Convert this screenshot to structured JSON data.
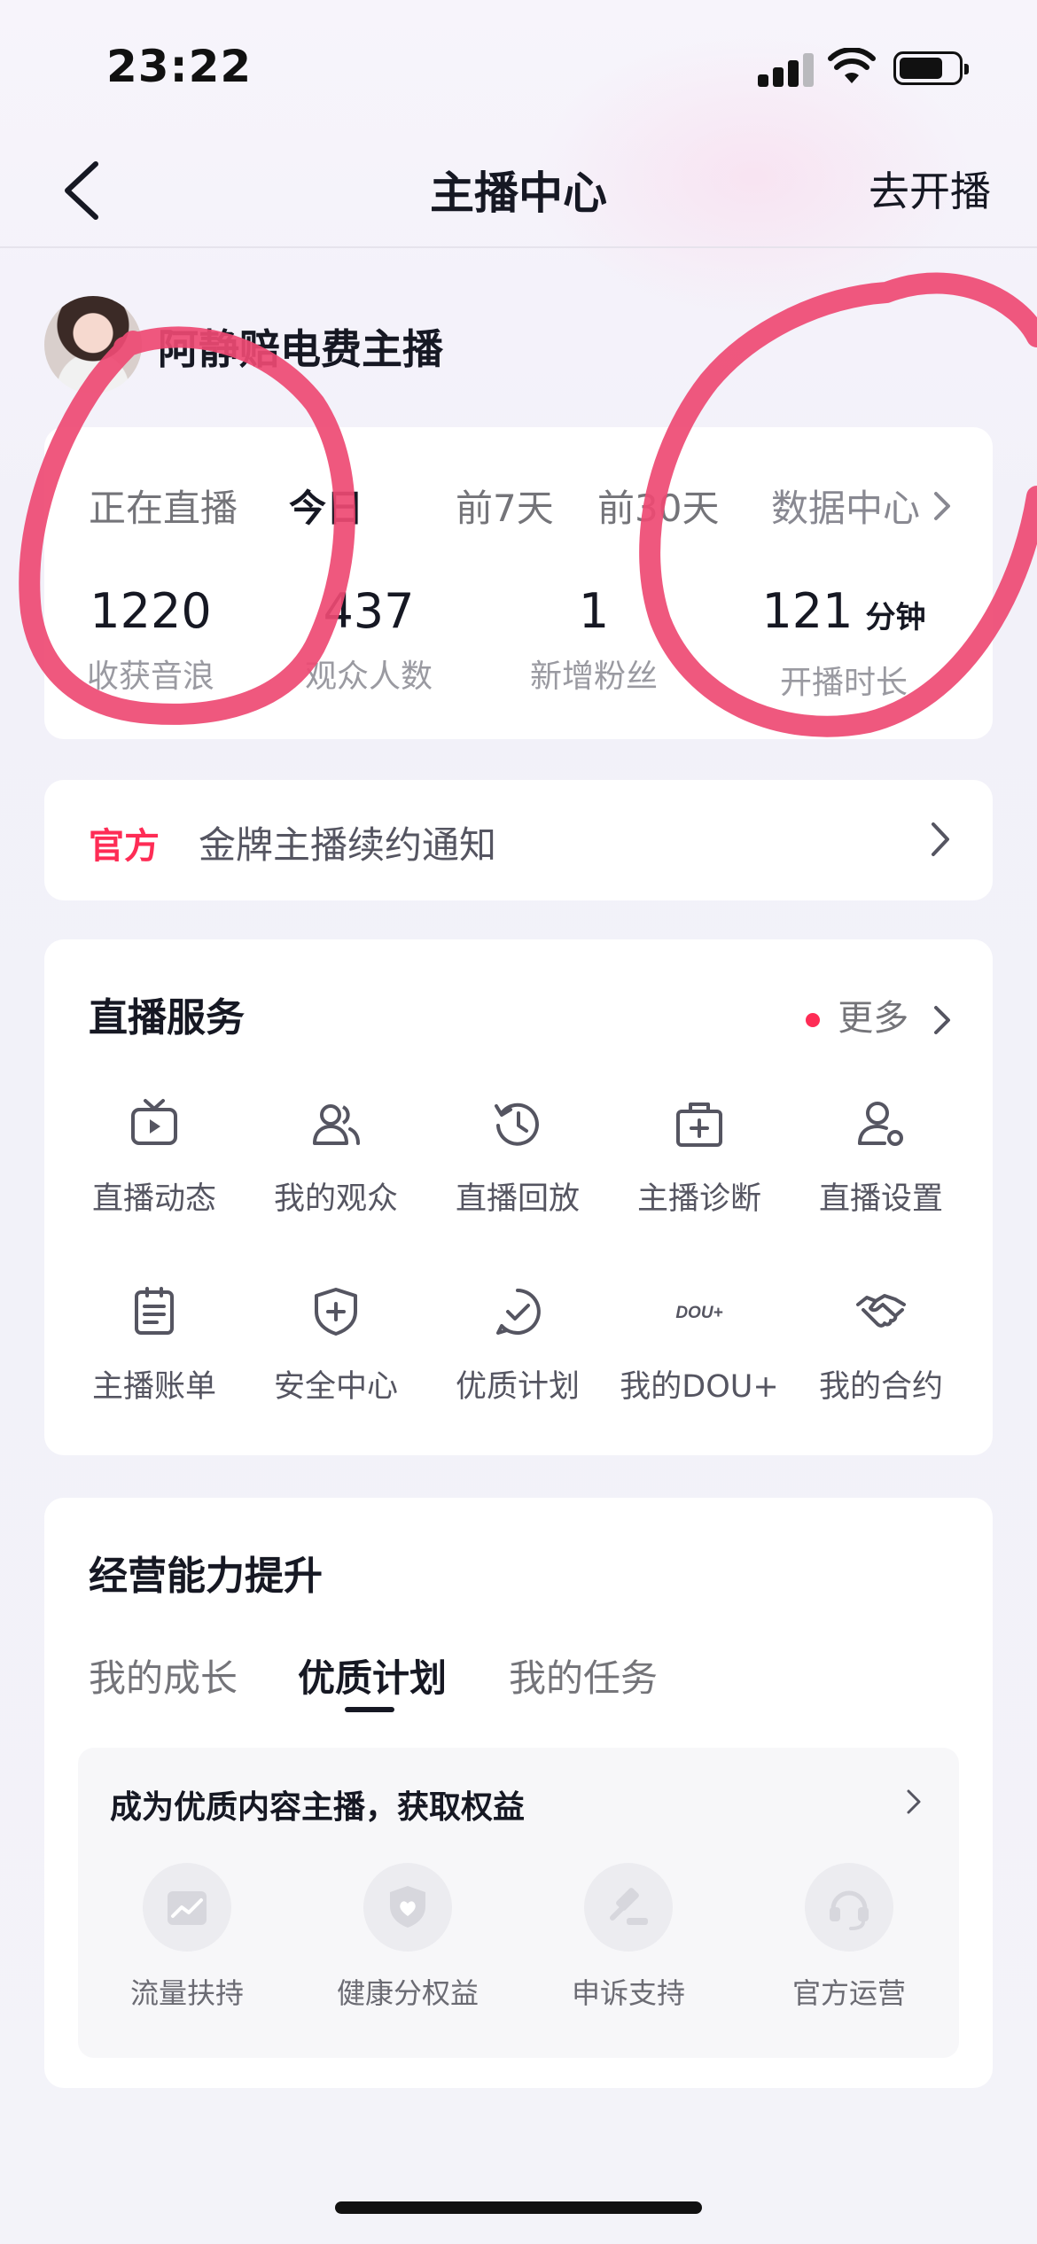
{
  "status_bar": {
    "time": "23:22",
    "signal_bars": 4,
    "battery_level": 0.75
  },
  "nav": {
    "title": "主播中心",
    "action": "去开播",
    "back_icon": "chevron-left-icon"
  },
  "profile": {
    "name": "阿静赔电费主播"
  },
  "stats": {
    "tabs": [
      "正在直播",
      "今日",
      "前7天",
      "前30天"
    ],
    "active_tab": "今日",
    "data_center_label": "数据中心",
    "items": [
      {
        "value": "1220",
        "label": "收获音浪",
        "unit": ""
      },
      {
        "value": "437",
        "label": "观众人数",
        "unit": ""
      },
      {
        "value": "1",
        "label": "新增粉丝",
        "unit": ""
      },
      {
        "value": "121",
        "label": "开播时长",
        "unit": "分钟"
      }
    ]
  },
  "notice": {
    "tag": "官方",
    "text": "金牌主播续约通知"
  },
  "services": {
    "title": "直播服务",
    "more_label": "更多",
    "accent": "#fe2c55",
    "items": [
      {
        "label": "直播动态",
        "icon": "tv-play-icon"
      },
      {
        "label": "我的观众",
        "icon": "audience-icon"
      },
      {
        "label": "直播回放",
        "icon": "replay-clock-icon"
      },
      {
        "label": "主播诊断",
        "icon": "medical-kit-icon"
      },
      {
        "label": "直播设置",
        "icon": "user-settings-icon"
      },
      {
        "label": "主播账单",
        "icon": "bill-icon"
      },
      {
        "label": "安全中心",
        "icon": "shield-plus-icon"
      },
      {
        "label": "优质计划",
        "icon": "check-bubble-icon"
      },
      {
        "label": "我的DOU+",
        "icon": "dou-plus-icon",
        "icon_text": "DOU+"
      },
      {
        "label": "我的合约",
        "icon": "handshake-icon"
      }
    ]
  },
  "business": {
    "title": "经营能力提升",
    "tabs": [
      "我的成长",
      "优质计划",
      "我的任务"
    ],
    "active_tab": "优质计划",
    "card_title": "成为优质内容主播，获取权益",
    "benefits": [
      {
        "label": "流量扶持",
        "icon": "traffic-chart-icon"
      },
      {
        "label": "健康分权益",
        "icon": "shield-heart-icon"
      },
      {
        "label": "申诉支持",
        "icon": "gavel-icon"
      },
      {
        "label": "官方运营",
        "icon": "headset-icon"
      }
    ]
  },
  "annotation_color": "#ee4a73"
}
